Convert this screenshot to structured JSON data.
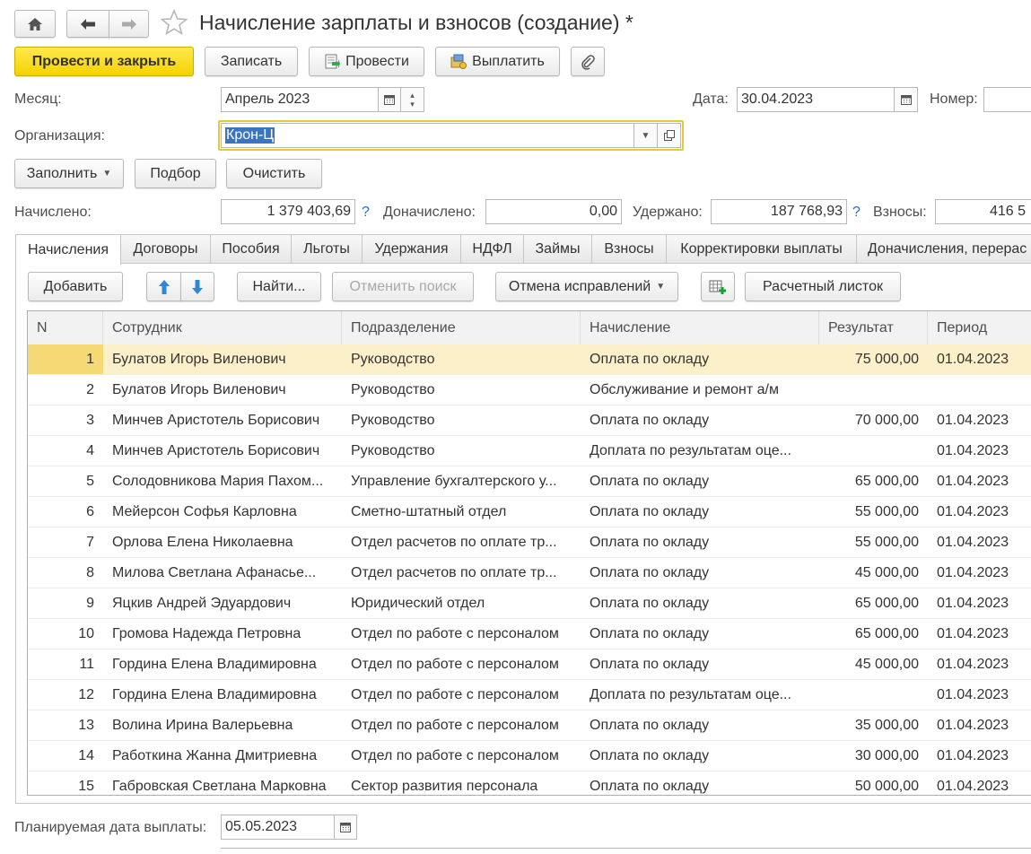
{
  "title": "Начисление зарплаты и взносов (создание) *",
  "commands": {
    "post_close": "Провести и закрыть",
    "save": "Записать",
    "post": "Провести",
    "pay": "Выплатить"
  },
  "header": {
    "month_label": "Месяц:",
    "month_value": "Апрель 2023",
    "date_label": "Дата:",
    "date_value": "30.04.2023",
    "number_label": "Номер:",
    "number_value": "",
    "org_label": "Организация:",
    "org_value": "Крон-Ц"
  },
  "actions": {
    "fill": "Заполнить",
    "pick": "Подбор",
    "clear": "Очистить"
  },
  "totals": {
    "accrued_label": "Начислено:",
    "accrued_value": "1 379 403,69",
    "extra_label": "Доначислено:",
    "extra_value": "0,00",
    "withheld_label": "Удержано:",
    "withheld_value": "187 768,93",
    "contrib_label": "Взносы:",
    "contrib_value": "416 5",
    "help": "?"
  },
  "tabs": [
    "Начисления",
    "Договоры",
    "Пособия",
    "Льготы",
    "Удержания",
    "НДФЛ",
    "Займы",
    "Взносы",
    "Корректировки выплаты",
    "Доначисления, перерас"
  ],
  "grid_toolbar": {
    "add": "Добавить",
    "find": "Найти...",
    "cancel_search": "Отменить поиск",
    "cancel_fixes": "Отмена исправлений",
    "payslip": "Расчетный листок"
  },
  "columns": [
    "N",
    "Сотрудник",
    "Подразделение",
    "Начисление",
    "Результат",
    "Период"
  ],
  "rows": [
    {
      "n": "1",
      "emp": "Булатов Игорь Виленович",
      "dept": "Руководство",
      "acc": "Оплата по окладу",
      "res": "75 000,00",
      "per": "01.04.2023"
    },
    {
      "n": "2",
      "emp": "Булатов Игорь Виленович",
      "dept": "Руководство",
      "acc": "Обслуживание и ремонт а/м",
      "res": "",
      "per": ""
    },
    {
      "n": "3",
      "emp": "Минчев Аристотель Борисович",
      "dept": "Руководство",
      "acc": "Оплата по окладу",
      "res": "70 000,00",
      "per": "01.04.2023"
    },
    {
      "n": "4",
      "emp": "Минчев Аристотель Борисович",
      "dept": "Руководство",
      "acc": "Доплата по результатам оце...",
      "res": "",
      "per": "01.04.2023"
    },
    {
      "n": "5",
      "emp": "Солодовникова Мария Пахом...",
      "dept": "Управление бухгалтерского у...",
      "acc": "Оплата по окладу",
      "res": "65 000,00",
      "per": "01.04.2023"
    },
    {
      "n": "6",
      "emp": "Мейерсон Софья Карловна",
      "dept": "Сметно-штатный отдел",
      "acc": "Оплата по окладу",
      "res": "55 000,00",
      "per": "01.04.2023"
    },
    {
      "n": "7",
      "emp": "Орлова Елена Николаевна",
      "dept": "Отдел расчетов по оплате тр...",
      "acc": "Оплата по окладу",
      "res": "55 000,00",
      "per": "01.04.2023"
    },
    {
      "n": "8",
      "emp": "Милова Светлана Афанасье...",
      "dept": "Отдел расчетов по оплате тр...",
      "acc": "Оплата по окладу",
      "res": "45 000,00",
      "per": "01.04.2023"
    },
    {
      "n": "9",
      "emp": "Яцкив Андрей Эдуардович",
      "dept": "Юридический отдел",
      "acc": "Оплата по окладу",
      "res": "65 000,00",
      "per": "01.04.2023"
    },
    {
      "n": "10",
      "emp": "Громова Надежда Петровна",
      "dept": "Отдел по работе с персоналом",
      "acc": "Оплата по окладу",
      "res": "65 000,00",
      "per": "01.04.2023"
    },
    {
      "n": "11",
      "emp": "Гордина Елена Владимировна",
      "dept": "Отдел по работе с персоналом",
      "acc": "Оплата по окладу",
      "res": "45 000,00",
      "per": "01.04.2023"
    },
    {
      "n": "12",
      "emp": "Гордина Елена Владимировна",
      "dept": "Отдел по работе с персоналом",
      "acc": "Доплата по результатам оце...",
      "res": "",
      "per": "01.04.2023"
    },
    {
      "n": "13",
      "emp": "Волина Ирина Валерьевна",
      "dept": "Отдел по работе с персоналом",
      "acc": "Оплата по окладу",
      "res": "35 000,00",
      "per": "01.04.2023"
    },
    {
      "n": "14",
      "emp": "Работкина Жанна Дмитриевна",
      "dept": "Отдел по работе с персоналом",
      "acc": "Оплата по окладу",
      "res": "30 000,00",
      "per": "01.04.2023"
    },
    {
      "n": "15",
      "emp": "Габровская Светлана Марковна",
      "dept": "Сектор развития персонала",
      "acc": "Оплата по окладу",
      "res": "50 000,00",
      "per": "01.04.2023"
    }
  ],
  "footer": {
    "pay_date_label": "Планируемая дата выплаты:",
    "pay_date_value": "05.05.2023"
  },
  "colors": {
    "accent_yellow": "#f4d200",
    "selected_row": "#fbf0c9",
    "help_blue": "#1d6fd0",
    "focus_border": "#e8c83a"
  }
}
